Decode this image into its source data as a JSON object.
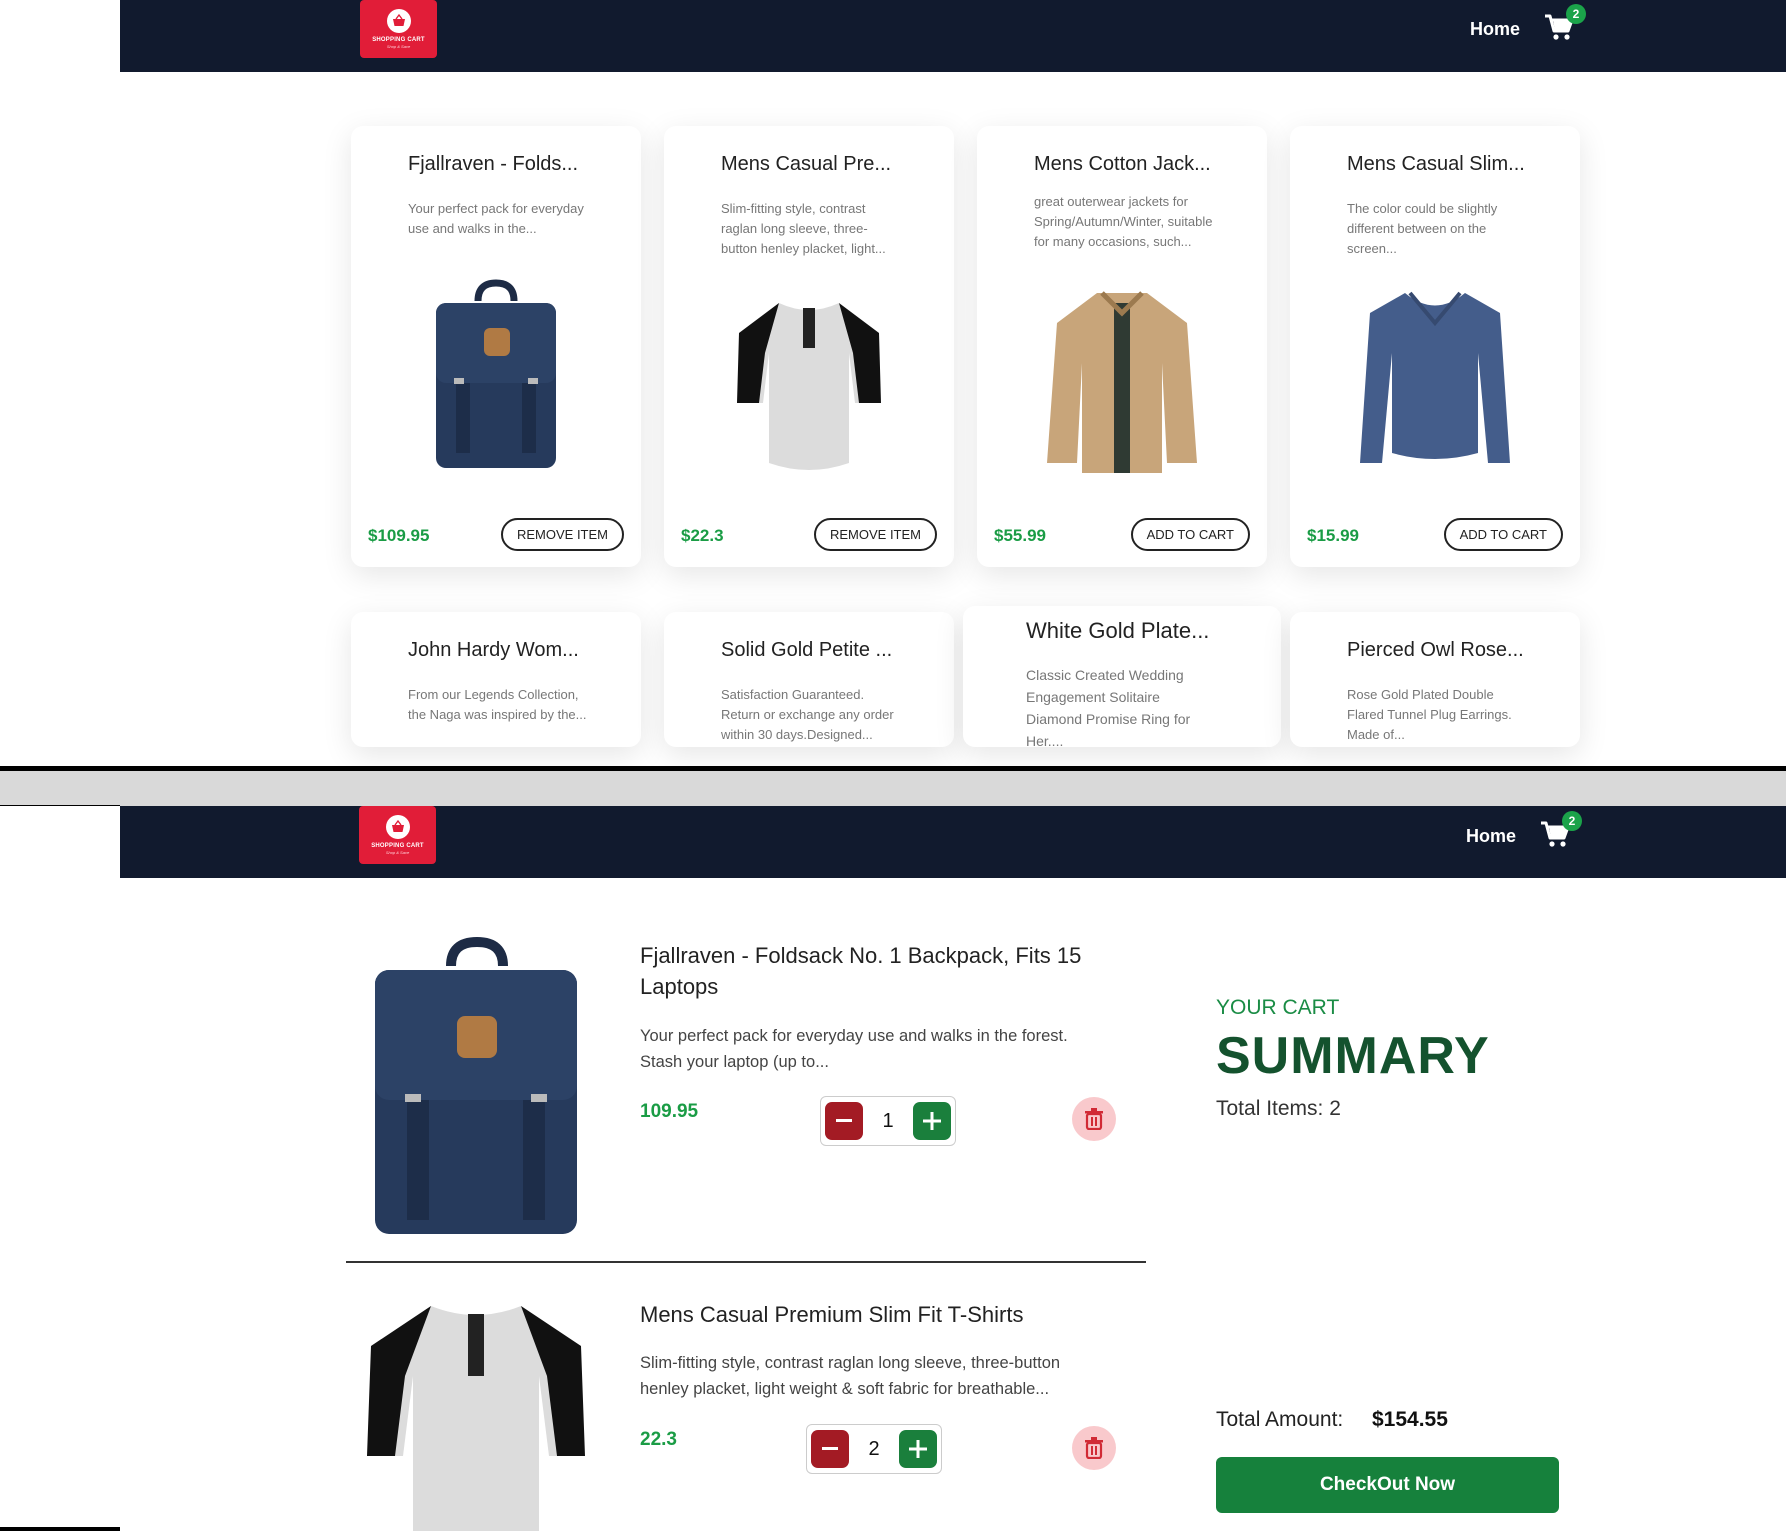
{
  "brand": {
    "logo_text": "SHOPPING CART",
    "logo_sub": "Shop & Save"
  },
  "nav": {
    "home_label": "Home",
    "cart_count": "2"
  },
  "colors": {
    "navbar": "#111a2e",
    "logo": "#e11d38",
    "price": "#1a9c45",
    "checkout": "#16813c",
    "badge": "#1ba34a"
  },
  "products": [
    {
      "title": "Fjallraven - Folds...",
      "desc": "Your perfect pack for everyday use and walks in the...",
      "price": "$109.95",
      "button": "REMOVE ITEM",
      "image": "backpack-icon"
    },
    {
      "title": "Mens Casual Pre...",
      "desc": "Slim-fitting style, contrast raglan long sleeve, three-button henley placket, light...",
      "price": "$22.3",
      "button": "REMOVE ITEM",
      "image": "tshirt-icon"
    },
    {
      "title": "Mens Cotton Jack...",
      "desc": "great outerwear jackets for Spring/Autumn/Winter, suitable for many occasions, such...",
      "price": "$55.99",
      "button": "ADD TO CART",
      "image": "jacket-icon"
    },
    {
      "title": "Mens Casual Slim...",
      "desc": "The color could be slightly different between on the screen...",
      "price": "$15.99",
      "button": "ADD TO CART",
      "image": "sweater-icon"
    },
    {
      "title": "John Hardy Wom...",
      "desc": "From our Legends Collection, the Naga was inspired by the..."
    },
    {
      "title": "Solid Gold Petite ...",
      "desc": "Satisfaction Guaranteed. Return or exchange any order within 30 days.Designed..."
    },
    {
      "title": "White Gold Plate...",
      "desc": "Classic Created Wedding Engagement Solitaire Diamond Promise Ring for Her...."
    },
    {
      "title": "Pierced Owl Rose...",
      "desc": "Rose Gold Plated Double Flared Tunnel Plug Earrings. Made of..."
    }
  ],
  "cart": {
    "items": [
      {
        "title": "Fjallraven - Foldsack No. 1 Backpack, Fits 15 Laptops",
        "desc": "Your perfect pack for everyday use and walks in the forest. Stash your laptop (up to...",
        "price": "109.95",
        "qty": "1",
        "image": "backpack-icon"
      },
      {
        "title": "Mens Casual Premium Slim Fit T-Shirts",
        "desc": "Slim-fitting style, contrast raglan long sleeve, three-button henley placket, light weight & soft fabric for breathable...",
        "price": "22.3",
        "qty": "2",
        "image": "tshirt-icon"
      }
    ],
    "summary": {
      "kicker": "YOUR CART",
      "title": "SUMMARY",
      "total_items": "Total Items: 2",
      "total_amount_label": "Total Amount:",
      "total_amount": "$154.55",
      "checkout_label": "CheckOut Now"
    }
  }
}
